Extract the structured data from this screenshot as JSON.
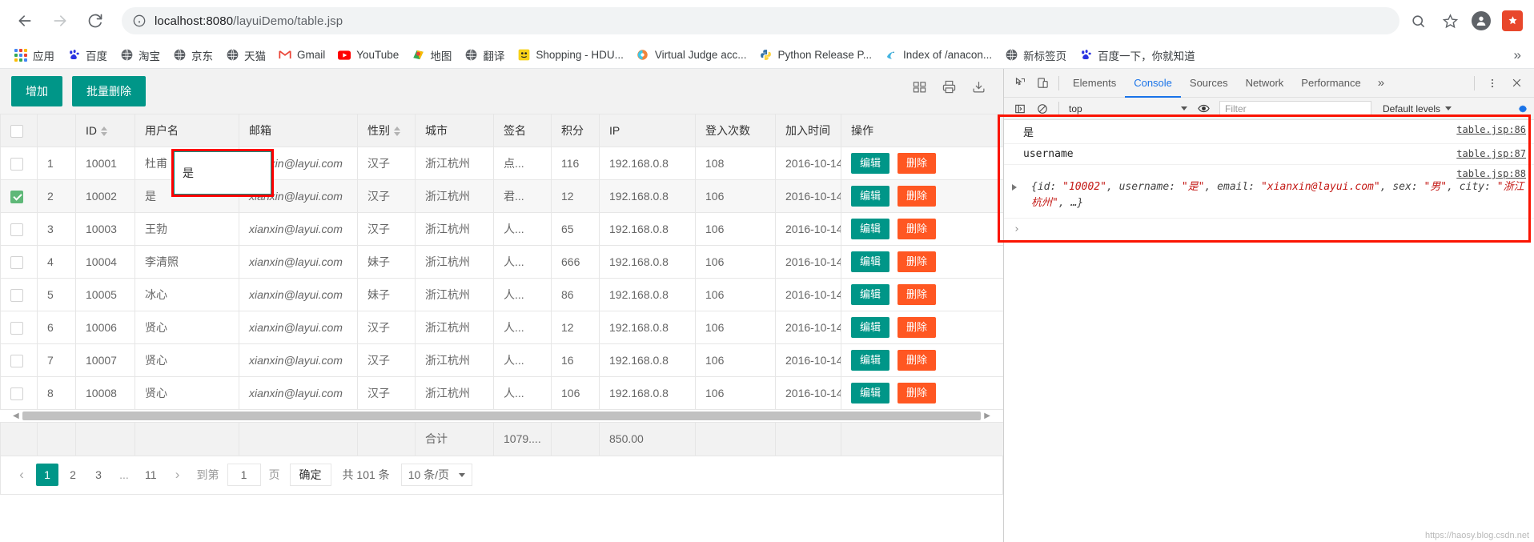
{
  "browser": {
    "back_title": "Back",
    "forward_title": "Forward",
    "reload_title": "Reload",
    "url_host": "localhost:8080",
    "url_path": "/layuiDemo/table.jsp",
    "zoom_icon": "search-icon",
    "bookmark_icon": "star-icon",
    "profile_icon": "avatar-icon",
    "extension_icon": "extension-icon"
  },
  "bookmarks": [
    {
      "label": "应用",
      "icon": "apps-grid-icon"
    },
    {
      "label": "百度",
      "icon": "baidu-icon"
    },
    {
      "label": "淘宝",
      "icon": "globe-icon"
    },
    {
      "label": "京东",
      "icon": "globe-icon"
    },
    {
      "label": "天猫",
      "icon": "globe-icon"
    },
    {
      "label": "Gmail",
      "icon": "gmail-icon"
    },
    {
      "label": "YouTube",
      "icon": "youtube-icon"
    },
    {
      "label": "地图",
      "icon": "maps-icon"
    },
    {
      "label": "翻译",
      "icon": "globe-icon"
    },
    {
      "label": "Shopping - HDU...",
      "icon": "emoji-icon"
    },
    {
      "label": "Virtual Judge acc...",
      "icon": "vjudge-icon"
    },
    {
      "label": "Python Release P...",
      "icon": "python-icon"
    },
    {
      "label": "Index of /anacon...",
      "icon": "anaconda-icon"
    },
    {
      "label": "新标签页",
      "icon": "globe-icon"
    },
    {
      "label": "百度一下，你就知道",
      "icon": "baidu-icon"
    }
  ],
  "bookmarks_overflow": "»",
  "page": {
    "toolbar": {
      "add_label": "增加",
      "batch_delete_label": "批量删除",
      "icons": [
        "columns-filter-icon",
        "print-icon",
        "export-icon"
      ]
    },
    "columns": [
      {
        "key": "checkbox",
        "label": "",
        "sortable": false
      },
      {
        "key": "index",
        "label": "",
        "sortable": false
      },
      {
        "key": "id",
        "label": "ID",
        "sortable": true
      },
      {
        "key": "username",
        "label": "用户名",
        "sortable": false
      },
      {
        "key": "email",
        "label": "邮箱",
        "sortable": false
      },
      {
        "key": "sex",
        "label": "性别",
        "sortable": true
      },
      {
        "key": "city",
        "label": "城市",
        "sortable": false
      },
      {
        "key": "sign",
        "label": "签名",
        "sortable": false
      },
      {
        "key": "experience",
        "label": "积分",
        "sortable": false
      },
      {
        "key": "ip",
        "label": "IP",
        "sortable": false
      },
      {
        "key": "logins",
        "label": "登入次数",
        "sortable": false
      },
      {
        "key": "joinTime",
        "label": "加入时间",
        "sortable": false
      },
      {
        "key": "ops",
        "label": "操作",
        "sortable": false
      }
    ],
    "rows": [
      {
        "checked": false,
        "index": "1",
        "id": "10001",
        "username": "杜甫",
        "email": "xianxin@layui.com",
        "sex": "汉子",
        "city": "浙江杭州",
        "sign": "点...",
        "experience": "116",
        "ip": "192.168.0.8",
        "logins": "108",
        "joinTime": "2016-10-14"
      },
      {
        "checked": true,
        "index": "2",
        "id": "10002",
        "username": "是",
        "email": "xianxin@layui.com",
        "sex": "汉子",
        "city": "浙江杭州",
        "sign": "君...",
        "experience": "12",
        "ip": "192.168.0.8",
        "logins": "106",
        "joinTime": "2016-10-14"
      },
      {
        "checked": false,
        "index": "3",
        "id": "10003",
        "username": "王勃",
        "email": "xianxin@layui.com",
        "sex": "汉子",
        "city": "浙江杭州",
        "sign": "人...",
        "experience": "65",
        "ip": "192.168.0.8",
        "logins": "106",
        "joinTime": "2016-10-14"
      },
      {
        "checked": false,
        "index": "4",
        "id": "10004",
        "username": "李清照",
        "email": "xianxin@layui.com",
        "sex": "妹子",
        "city": "浙江杭州",
        "sign": "人...",
        "experience": "666",
        "ip": "192.168.0.8",
        "logins": "106",
        "joinTime": "2016-10-14"
      },
      {
        "checked": false,
        "index": "5",
        "id": "10005",
        "username": "冰心",
        "email": "xianxin@layui.com",
        "sex": "妹子",
        "city": "浙江杭州",
        "sign": "人...",
        "experience": "86",
        "ip": "192.168.0.8",
        "logins": "106",
        "joinTime": "2016-10-14"
      },
      {
        "checked": false,
        "index": "6",
        "id": "10006",
        "username": "贤心",
        "email": "xianxin@layui.com",
        "sex": "汉子",
        "city": "浙江杭州",
        "sign": "人...",
        "experience": "12",
        "ip": "192.168.0.8",
        "logins": "106",
        "joinTime": "2016-10-14"
      },
      {
        "checked": false,
        "index": "7",
        "id": "10007",
        "username": "贤心",
        "email": "xianxin@layui.com",
        "sex": "汉子",
        "city": "浙江杭州",
        "sign": "人...",
        "experience": "16",
        "ip": "192.168.0.8",
        "logins": "106",
        "joinTime": "2016-10-14"
      },
      {
        "checked": false,
        "index": "8",
        "id": "10008",
        "username": "贤心",
        "email": "xianxin@layui.com",
        "sex": "汉子",
        "city": "浙江杭州",
        "sign": "人...",
        "experience": "106",
        "ip": "192.168.0.8",
        "logins": "106",
        "joinTime": "2016-10-14"
      }
    ],
    "row_ops": {
      "edit_label": "编辑",
      "delete_label": "删除"
    },
    "edit_cell": {
      "value": "是",
      "column": "username",
      "row_index": "2"
    },
    "totals": {
      "label": "合计",
      "experience": "1079....",
      "logins": "850.00"
    },
    "pagination": {
      "prev": "‹",
      "pages": [
        "1",
        "2",
        "3",
        "...",
        "11"
      ],
      "current": "1",
      "next": "›",
      "goto_prefix": "到第",
      "goto_value": "1",
      "goto_suffix": "页",
      "confirm": "确定",
      "total_text": "共 101 条",
      "page_size": "10 条/页"
    }
  },
  "devtools": {
    "tabs": [
      "Elements",
      "Console",
      "Sources",
      "Network",
      "Performance"
    ],
    "active_tab": "Console",
    "more": "»",
    "menu_icon": "kebab-menu-icon",
    "close_icon": "close-icon",
    "inspect_icon": "inspect-element-icon",
    "device_icon": "device-toolbar-icon",
    "subbar": {
      "sidebar_icon": "console-sidebar-icon",
      "clear_icon": "clear-console-icon",
      "context": "top",
      "eye_icon": "live-expression-icon",
      "filter_placeholder": "Filter",
      "levels": "Default levels",
      "settings_icon": "console-settings-icon"
    },
    "logs": [
      {
        "text": "是",
        "source": "table.jsp:86",
        "type": "text"
      },
      {
        "text": "username",
        "source": "table.jsp:87",
        "type": "text"
      },
      {
        "type": "object",
        "source": "table.jsp:88",
        "parts": [
          {
            "t": "{id: ",
            "s": false
          },
          {
            "t": "\"10002\"",
            "s": true
          },
          {
            "t": ", username: ",
            "s": false
          },
          {
            "t": "\"是\"",
            "s": true
          },
          {
            "t": ", email: ",
            "s": false
          },
          {
            "t": "\"xianxin@layui.com\"",
            "s": true
          },
          {
            "t": ", sex: ",
            "s": false
          },
          {
            "t": "\"男\"",
            "s": true
          },
          {
            "t": ", city: ",
            "s": false
          },
          {
            "t": "\"浙江杭州\"",
            "s": true
          },
          {
            "t": ", …}",
            "s": false
          }
        ]
      }
    ],
    "prompt": "›"
  },
  "watermark": "https://haosy.blog.csdn.net"
}
